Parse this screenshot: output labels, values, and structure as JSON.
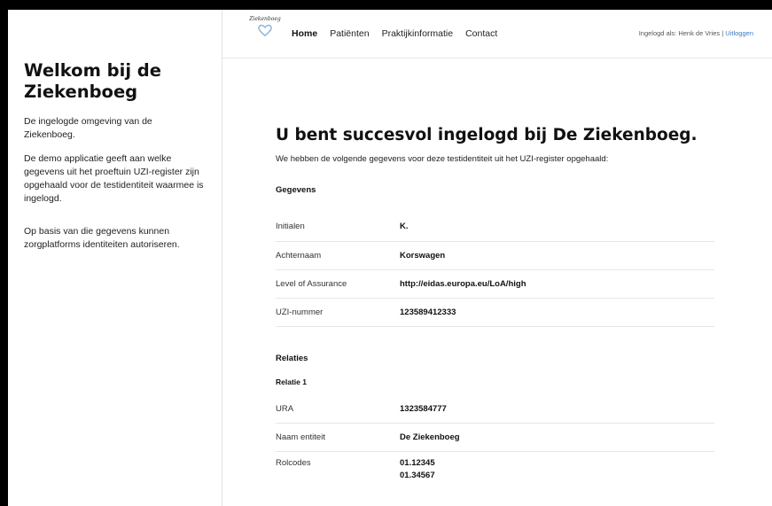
{
  "sidebar": {
    "heading": "Welkom bij de Ziekenboeg",
    "paragraphs": [
      "De ingelogde omgeving van de Ziekenboeg.",
      "De demo applicatie geeft aan welke gegevens uit het proeftuin UZI-register zijn opgehaald voor de testidentiteit waarmee is ingelogd.",
      "Op basis van die gegevens kunnen zorgplatforms identiteiten autoriseren."
    ]
  },
  "header": {
    "logo_text": "Ziekenboeg",
    "nav": [
      "Home",
      "Patiënten",
      "Praktijkinformatie",
      "Contact"
    ],
    "user_label": "Ingelogd als: Henk de Vries",
    "separator": "|",
    "logout_label": "Uitloggen"
  },
  "main": {
    "title": "U bent succesvol ingelogd bij De Ziekenboeg.",
    "intro": "We hebben de volgende gegevens voor deze testidentiteit uit het UZI-register opgehaald:",
    "gegevens_title": "Gegevens",
    "gegevens": [
      {
        "label": "Initialen",
        "value": "K."
      },
      {
        "label": "Achternaam",
        "value": "Korswagen"
      },
      {
        "label": "Level of Assurance",
        "value": "http://eidas.europa.eu/LoA/high"
      },
      {
        "label": "UZI-nummer",
        "value": "123589412333"
      }
    ],
    "relaties_title": "Relaties",
    "relatie_title": "Relatie 1",
    "relatie": [
      {
        "label": "URA",
        "value": "1323584777"
      },
      {
        "label": "Naam entiteit",
        "value": "De Ziekenboeg"
      }
    ],
    "rolcodes_label": "Rolcodes",
    "rolcodes": [
      "01.12345",
      "01.34567"
    ]
  },
  "colors": {
    "link": "#3a7dbf",
    "heart": "#8fb3d6"
  }
}
